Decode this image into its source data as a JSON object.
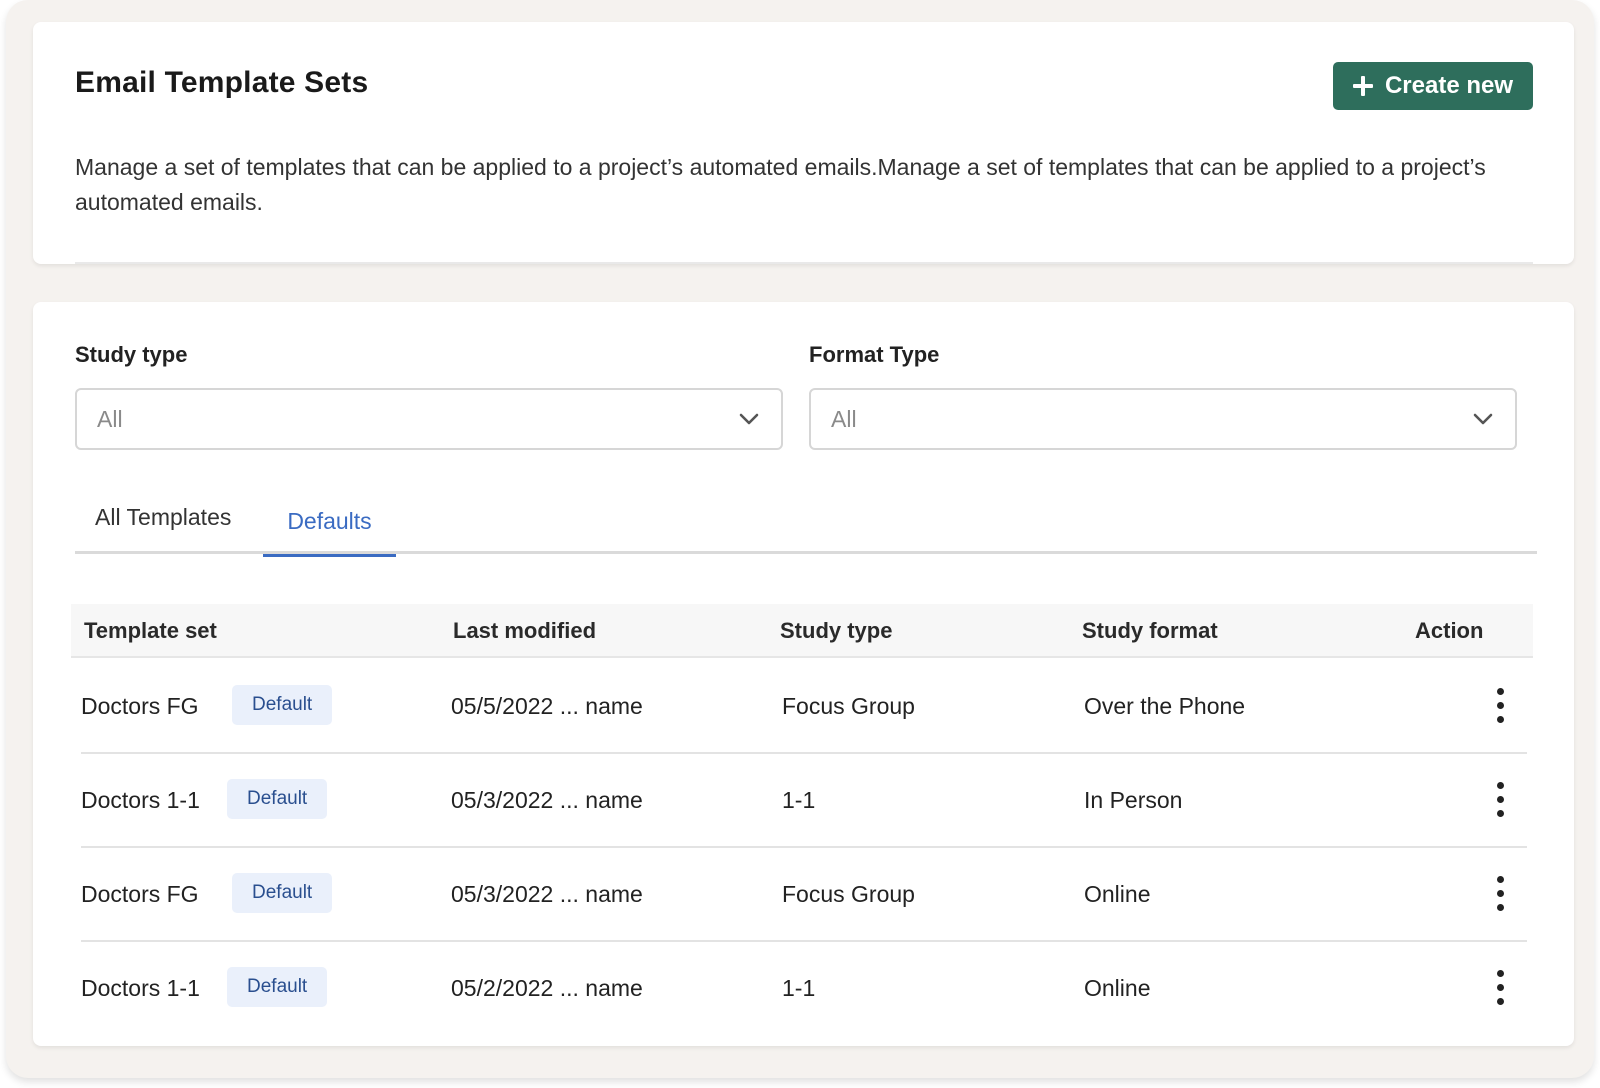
{
  "header": {
    "title": "Email Template Sets",
    "create_label": "Create new",
    "description": "Manage a set of templates that can be applied to a project’s automated emails.Manage a set of templates that can be applied to a project’s automated emails."
  },
  "filters": {
    "study_type": {
      "label": "Study type",
      "value": "All"
    },
    "format_type": {
      "label": "Format Type",
      "value": "All"
    }
  },
  "tabs": [
    {
      "label": "All Templates",
      "active": false
    },
    {
      "label": "Defaults",
      "active": true
    }
  ],
  "table": {
    "columns": [
      "Template set",
      "Last modified",
      "Study type",
      "Study format",
      "Action"
    ],
    "rows": [
      {
        "name": "Doctors FG",
        "badge": "Default",
        "modified": "05/5/2022 ... name",
        "study_type": "Focus Group",
        "format": "Over the Phone"
      },
      {
        "name": "Doctors 1-1",
        "badge": "Default",
        "modified": "05/3/2022 ... name",
        "study_type": "1-1",
        "format": "In Person"
      },
      {
        "name": "Doctors FG",
        "badge": "Default",
        "modified": "05/3/2022 ... name",
        "study_type": "Focus Group",
        "format": "Online"
      },
      {
        "name": "Doctors 1-1",
        "badge": "Default",
        "modified": "05/2/2022 ... name",
        "study_type": "1-1",
        "format": "Online"
      }
    ]
  },
  "icons": {
    "create": "plus-icon",
    "select": "chevron-down-icon",
    "action": "more-vertical-icon"
  },
  "colors": {
    "primary_button": "#2e6e5c",
    "active_tab": "#3a6bc2",
    "badge_bg": "#eaf0fb",
    "badge_text": "#2a4f8f",
    "background": "#f5f2ef"
  }
}
